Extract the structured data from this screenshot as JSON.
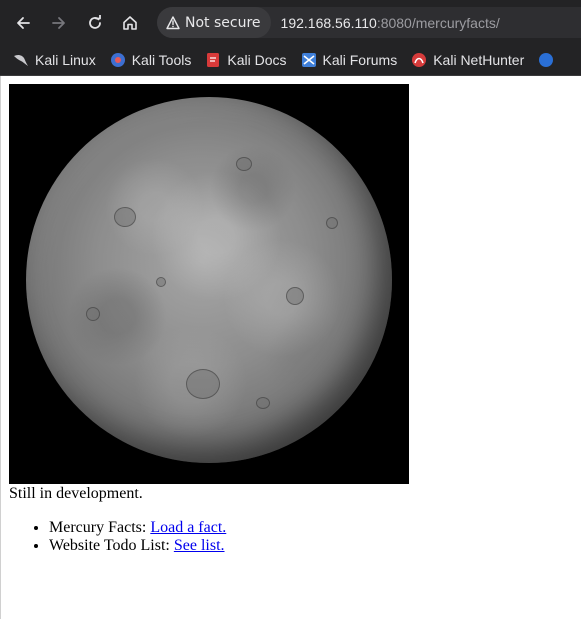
{
  "browser": {
    "security_label": "Not secure",
    "url_host": "192.168.56.110",
    "url_rest": ":8080/mercuryfacts/"
  },
  "bookmarks": [
    {
      "label": "Kali Linux",
      "icon": "kali-dragon-icon"
    },
    {
      "label": "Kali Tools",
      "icon": "kali-tools-icon"
    },
    {
      "label": "Kali Docs",
      "icon": "kali-docs-icon"
    },
    {
      "label": "Kali Forums",
      "icon": "kali-forums-icon"
    },
    {
      "label": "Kali NetHunter",
      "icon": "kali-nethunter-icon"
    }
  ],
  "page": {
    "status": "Still in development.",
    "items": [
      {
        "prefix": "Mercury Facts: ",
        "link": "Load a fact."
      },
      {
        "prefix": "Website Todo List: ",
        "link": "See list."
      }
    ]
  },
  "colors": {
    "chrome_bg": "#232325",
    "link": "#0000ee"
  }
}
